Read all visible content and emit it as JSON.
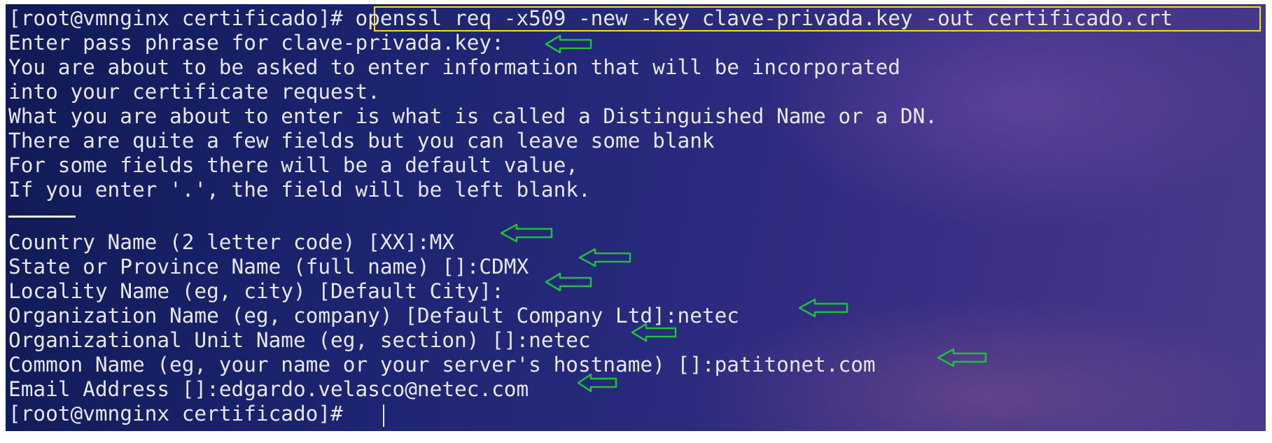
{
  "terminal": {
    "prompt": "[root@vmnginx certificado]# ",
    "command": "openssl req -x509 -new -key clave-privada.key -out certificado.crt",
    "intro_lines": [
      "Enter pass phrase for clave-privada.key:",
      "You are about to be asked to enter information that will be incorporated",
      "into your certificate request.",
      "What you are about to enter is what is called a Distinguished Name or a DN.",
      "There are quite a few fields but you can leave some blank",
      "For some fields there will be a default value,",
      "If you enter '.', the field will be left blank."
    ],
    "fields": [
      "Country Name (2 letter code) [XX]:MX",
      "State or Province Name (full name) []:CDMX",
      "Locality Name (eg, city) [Default City]:",
      "Organization Name (eg, company) [Default Company Ltd]:netec",
      "Organizational Unit Name (eg, section) []:netec",
      "Common Name (eg, your name or your server's hostname) []:patitonet.com",
      "Email Address []:edgardo.velasco@netec.com"
    ],
    "final_prompt": "[root@vmnginx certificado]#"
  },
  "annotation": {
    "highlight_color": "#f2e600",
    "arrow_color": "#1fbf3a",
    "arrow_icon": "left-arrow-icon"
  }
}
